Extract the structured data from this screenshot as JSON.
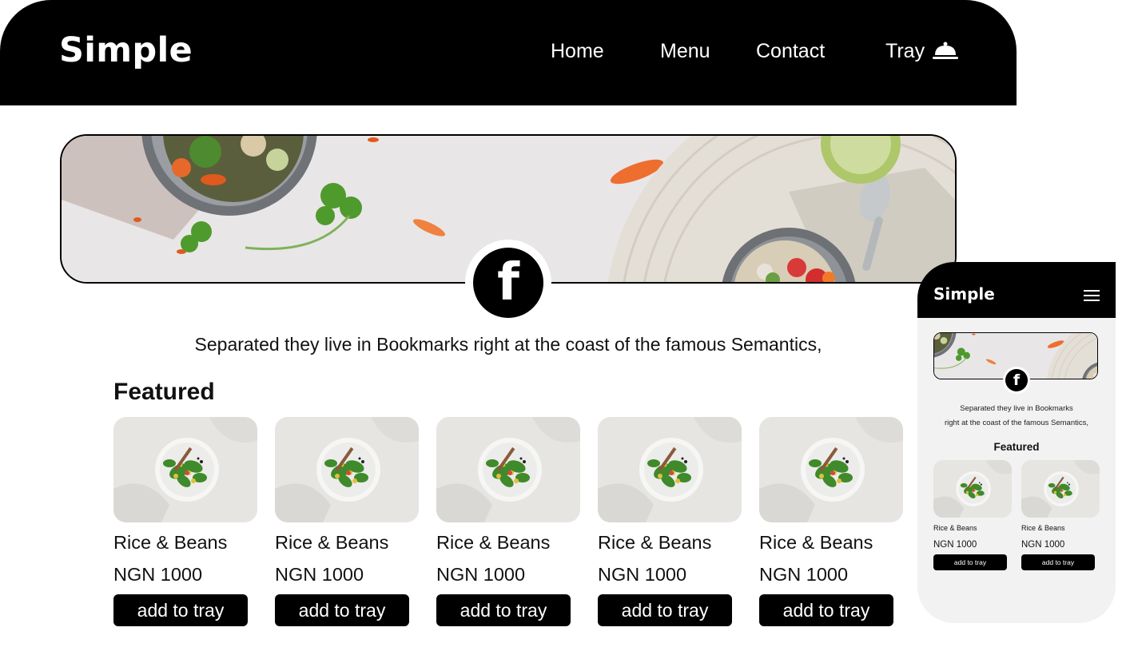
{
  "desktop": {
    "logo": "Simple",
    "nav": {
      "home": "Home",
      "menu": "Menu",
      "contact": "Contact",
      "tray": "Tray"
    },
    "tray_icon": "cloche-icon",
    "profile_icon": "facebook-icon",
    "profile_letter": "f",
    "tagline": "Separated they live in Bookmarks right at the coast of the famous Semantics,",
    "featured_heading": "Featured",
    "products": [
      {
        "name": "Rice & Beans",
        "price": "NGN 1000",
        "button": "add to tray"
      },
      {
        "name": "Rice & Beans",
        "price": "NGN 1000",
        "button": "add to tray"
      },
      {
        "name": "Rice & Beans",
        "price": "NGN 1000",
        "button": "add to tray"
      },
      {
        "name": "Rice & Beans",
        "price": "NGN 1000",
        "button": "add to tray"
      },
      {
        "name": "Rice & Beans",
        "price": "NGN 1000",
        "button": "add to tray"
      }
    ]
  },
  "mobile": {
    "logo": "Simple",
    "menu_icon": "hamburger-icon",
    "profile_letter": "f",
    "tagline_line1": "Separated they live in Bookmarks",
    "tagline_line2": "right at the coast of the famous Semantics,",
    "featured_heading": "Featured",
    "products": [
      {
        "name": "Rice & Beans",
        "price": "NGN 1000",
        "button": "add to tray"
      },
      {
        "name": "Rice & Beans",
        "price": "NGN 1000",
        "button": "add to tray"
      }
    ]
  },
  "colors": {
    "primary": "#000000",
    "surface": "#ffffff",
    "mobile_surface": "#f2f2f2"
  }
}
